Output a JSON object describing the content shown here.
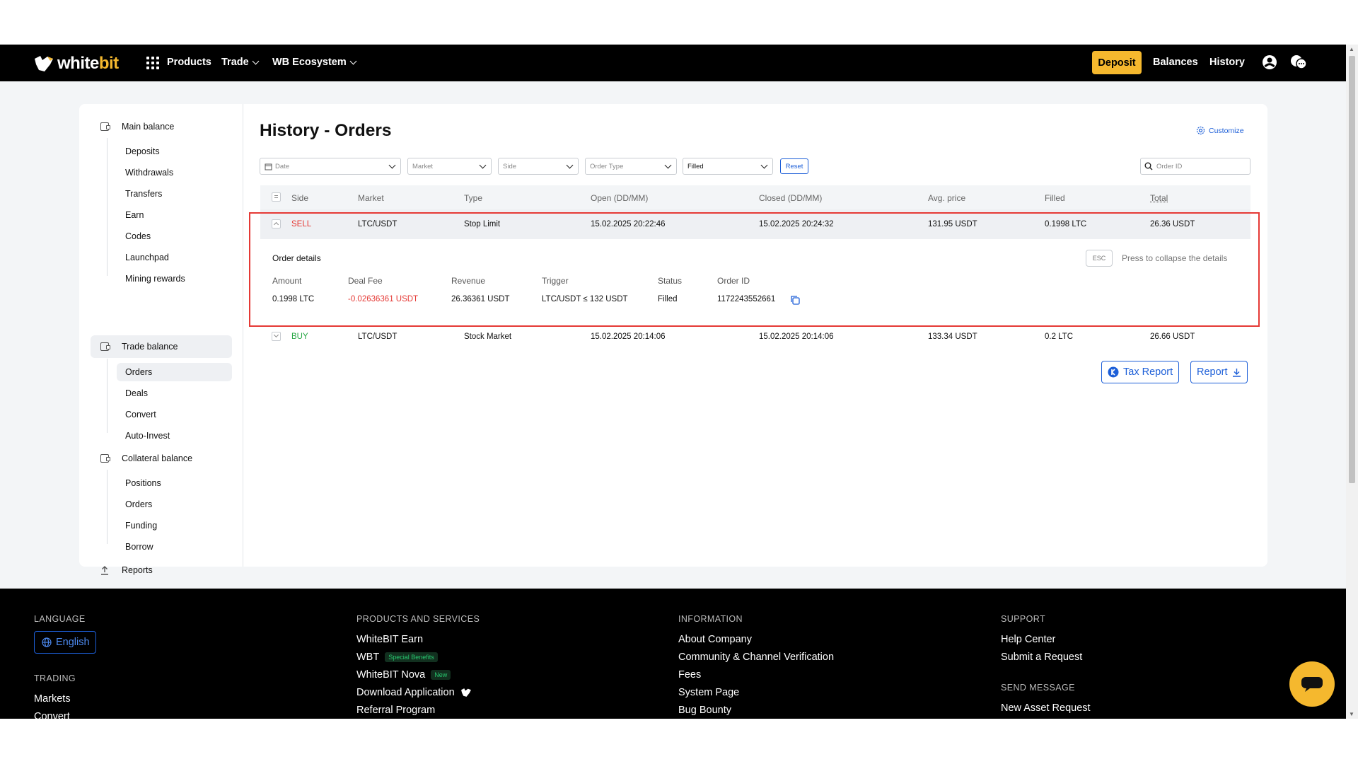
{
  "nav": {
    "logo_part1": "white",
    "logo_part2": "bit",
    "products": "Products",
    "trade": "Trade",
    "ecosystem": "WB Ecosystem",
    "deposit": "Deposit",
    "balances": "Balances",
    "history": "History"
  },
  "sidebar": {
    "main_balance": "Main balance",
    "main_items": [
      "Deposits",
      "Withdrawals",
      "Transfers",
      "Earn",
      "Codes",
      "Launchpad",
      "Mining rewards"
    ],
    "trade_balance": "Trade balance",
    "trade_items": [
      "Orders",
      "Deals",
      "Convert",
      "Auto-Invest"
    ],
    "collateral_balance": "Collateral balance",
    "collateral_items": [
      "Positions",
      "Orders",
      "Funding",
      "Borrow"
    ],
    "reports": "Reports"
  },
  "page": {
    "title": "History - Orders",
    "customize": "Customize"
  },
  "filters": {
    "date": "Date",
    "market": "Market",
    "side": "Side",
    "order_type": "Order Type",
    "status": "Filled",
    "reset": "Reset",
    "order_id_placeholder": "Order ID"
  },
  "table": {
    "headers": [
      "Side",
      "Market",
      "Type",
      "Open (DD/MM)",
      "Closed (DD/MM)",
      "Avg. price",
      "Filled",
      "Total"
    ],
    "rows": [
      {
        "side": "SELL",
        "market": "LTC/USDT",
        "type": "Stop Limit",
        "open": "15.02.2025 20:22:46",
        "closed": "15.02.2025 20:24:32",
        "avg": "131.95 USDT",
        "filled": "0.1998 LTC",
        "total": "26.36 USDT"
      },
      {
        "side": "BUY",
        "market": "LTC/USDT",
        "type": "Stock Market",
        "open": "15.02.2025 20:14:06",
        "closed": "15.02.2025 20:14:06",
        "avg": "133.34 USDT",
        "filled": "0.2 LTC",
        "total": "26.66 USDT"
      }
    ]
  },
  "details": {
    "title": "Order details",
    "esc": "ESC",
    "collapse_hint": "Press to collapse the details",
    "labels": [
      "Amount",
      "Deal Fee",
      "Revenue",
      "Trigger",
      "Status",
      "Order ID"
    ],
    "values": [
      "0.1998 LTC",
      "-0.02636361 USDT",
      "26.36361 USDT",
      "LTC/USDT ≤ 132 USDT",
      "Filled",
      "1172243552661"
    ]
  },
  "actions": {
    "tax_report": "Tax Report",
    "report": "Report"
  },
  "footer": {
    "language_heading": "LANGUAGE",
    "language": "English",
    "trading_heading": "TRADING",
    "trading_links": [
      "Markets",
      "Convert"
    ],
    "products_heading": "PRODUCTS AND SERVICES",
    "products_links": [
      "WhiteBIT Earn",
      "WBT",
      "WhiteBIT Nova",
      "Download Application",
      "Referral Program"
    ],
    "wbt_badge": "Special Benefits",
    "nova_badge": "New",
    "info_heading": "INFORMATION",
    "info_links": [
      "About Company",
      "Community & Channel Verification",
      "Fees",
      "System Page",
      "Bug Bounty"
    ],
    "support_heading": "SUPPORT",
    "support_links": [
      "Help Center",
      "Submit a Request"
    ],
    "send_heading": "SEND MESSAGE",
    "send_links": [
      "New Asset Request"
    ]
  },
  "colors": {
    "accent": "#f5b82e",
    "blue": "#1d5fd8",
    "sell": "#e53935",
    "buy": "#28a745"
  }
}
